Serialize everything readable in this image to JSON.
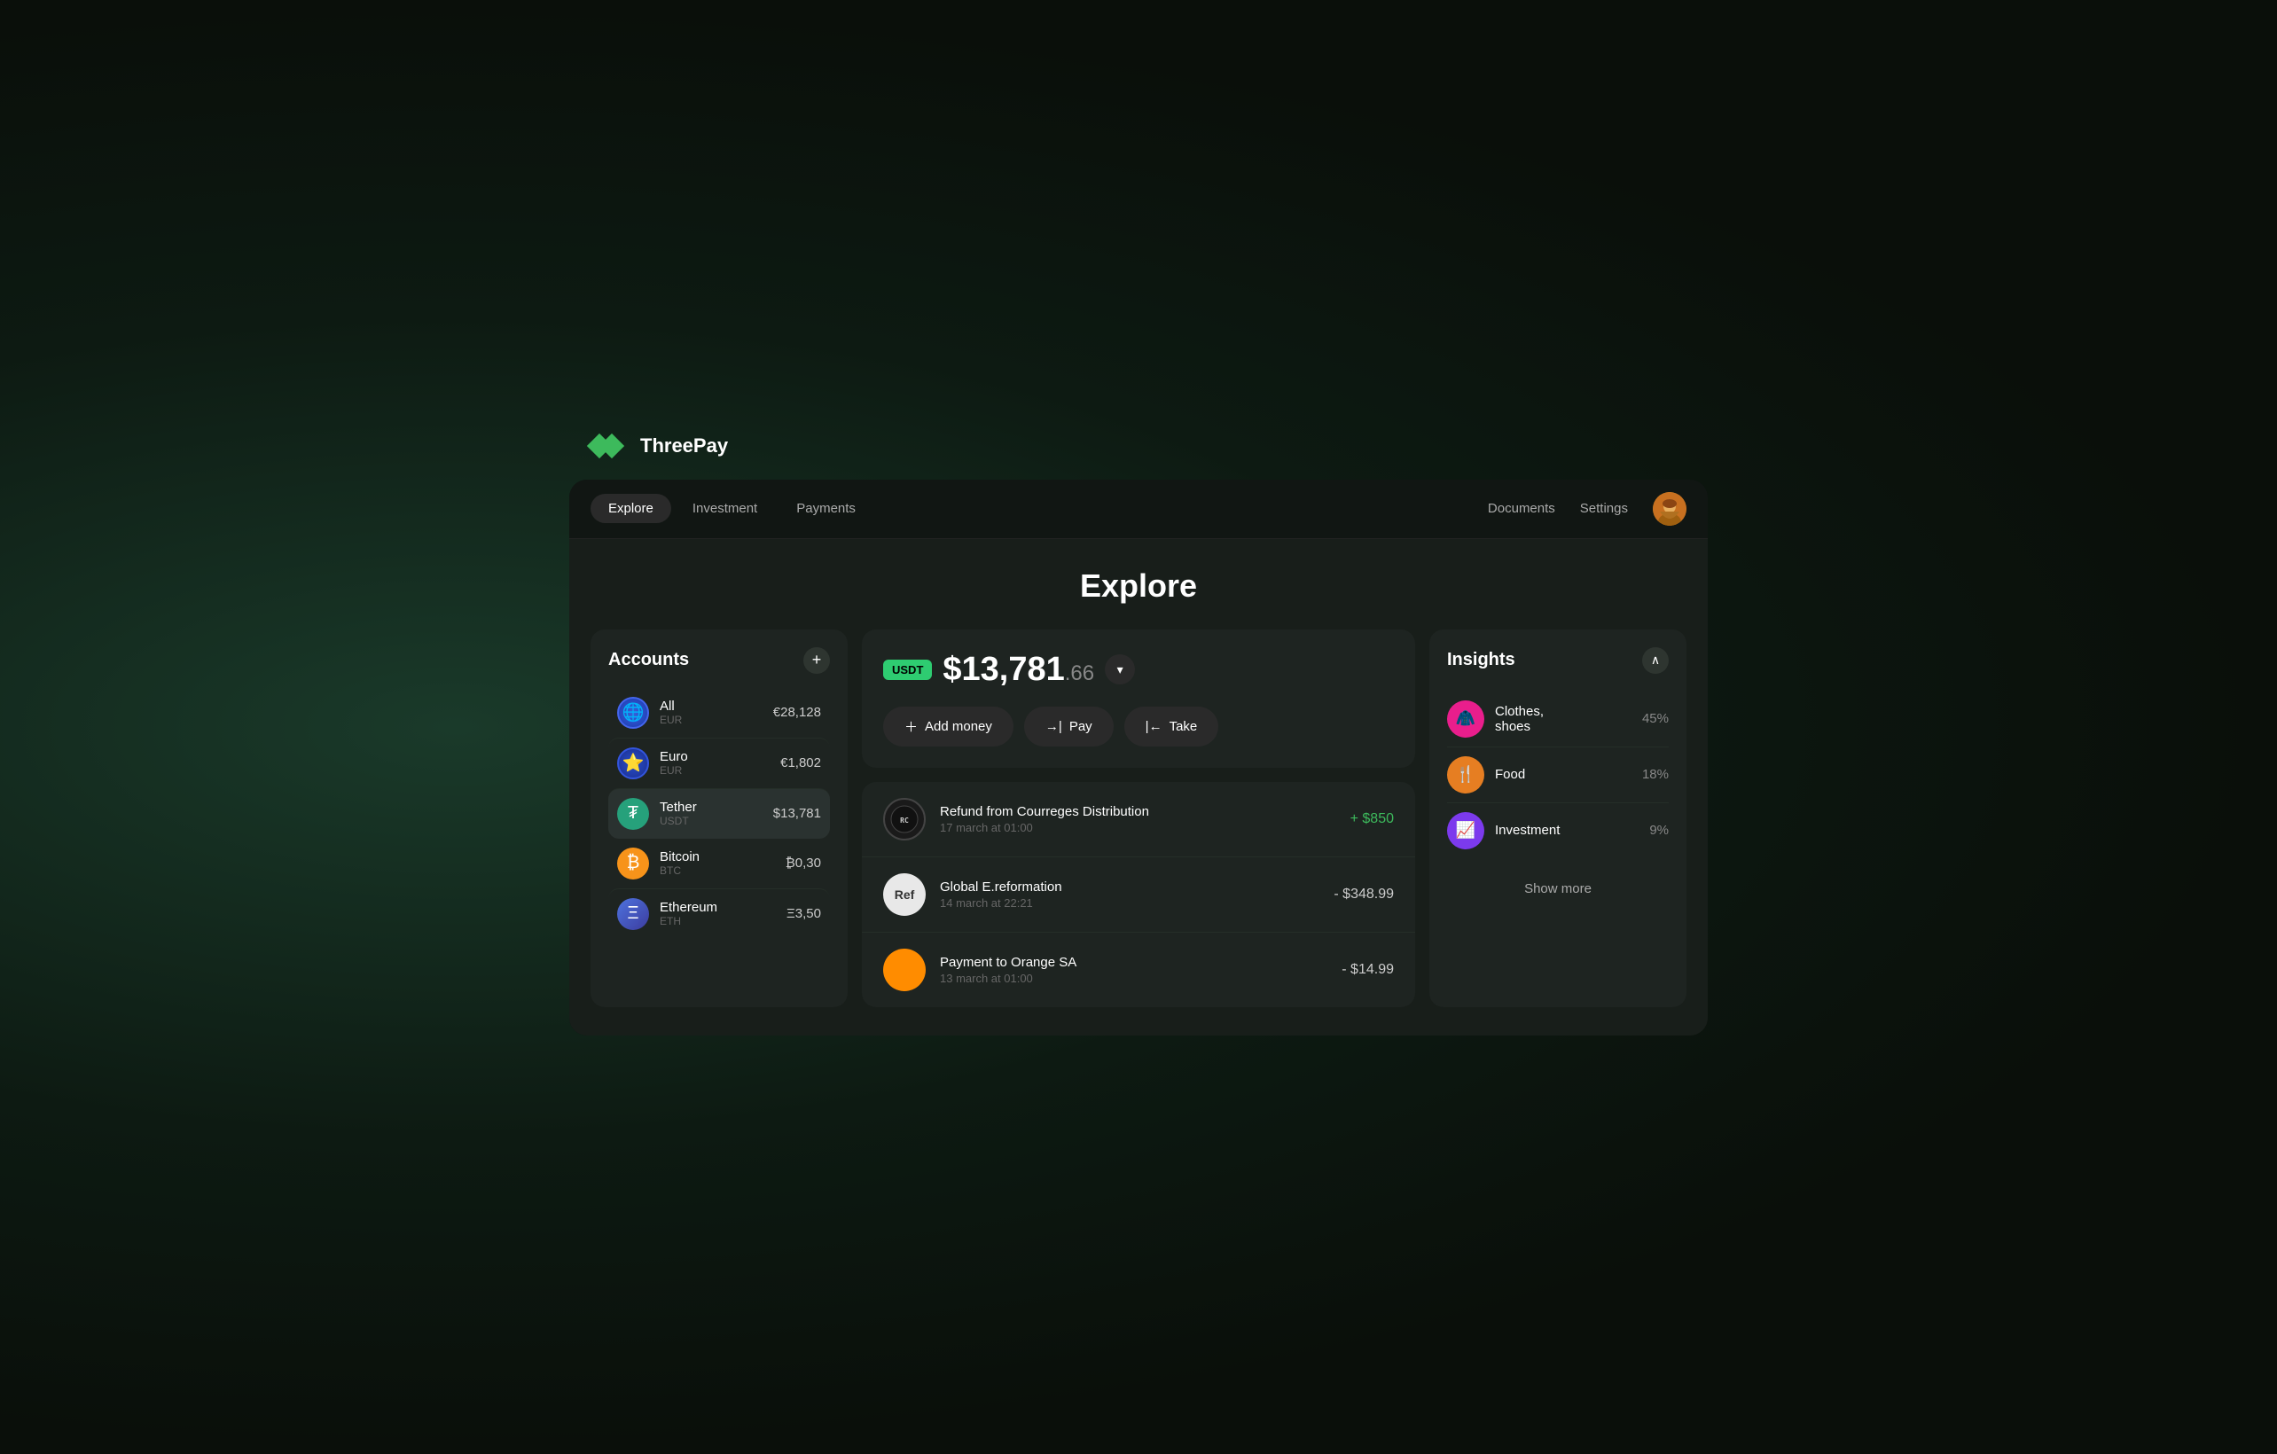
{
  "app": {
    "name": "ThreePay"
  },
  "nav": {
    "tabs": [
      {
        "id": "explore",
        "label": "Explore",
        "active": true
      },
      {
        "id": "investment",
        "label": "Investment",
        "active": false
      },
      {
        "id": "payments",
        "label": "Payments",
        "active": false
      }
    ],
    "links": [
      {
        "id": "documents",
        "label": "Documents"
      },
      {
        "id": "settings",
        "label": "Settings"
      }
    ]
  },
  "page": {
    "title": "Explore"
  },
  "accounts": {
    "title": "Accounts",
    "add_label": "+",
    "items": [
      {
        "id": "all",
        "name": "All",
        "sub": "EUR",
        "balance": "€28,128",
        "icon": "🌐",
        "icon_bg": "#2655d8",
        "active": false
      },
      {
        "id": "euro",
        "name": "Euro",
        "sub": "EUR",
        "balance": "€1,802",
        "icon": "🇪🇺",
        "icon_bg": "#1a3a9e",
        "active": false
      },
      {
        "id": "tether",
        "name": "Tether",
        "sub": "USDT",
        "balance": "$13,781",
        "icon": "₮",
        "icon_bg": "#26a17b",
        "active": true
      },
      {
        "id": "bitcoin",
        "name": "Bitcoin",
        "sub": "BTC",
        "balance": "₿0,30",
        "icon": "₿",
        "icon_bg": "#f7931a",
        "active": false
      },
      {
        "id": "ethereum",
        "name": "Ethereum",
        "sub": "ETH",
        "balance": "Ξ3,50",
        "icon": "Ξ",
        "icon_bg": "#3c3c8e",
        "active": false
      }
    ]
  },
  "balance": {
    "currency_badge": "USDT",
    "amount_main": "$13,781",
    "amount_cents": ".66"
  },
  "actions": [
    {
      "id": "add-money",
      "label": "Add money",
      "icon": "+"
    },
    {
      "id": "pay",
      "label": "Pay",
      "icon": "→|"
    },
    {
      "id": "take",
      "label": "Take",
      "icon": "|←"
    }
  ],
  "transactions": [
    {
      "id": "tx1",
      "name": "Refund from Courreges Distribution",
      "date": "17 march at 01:00",
      "amount": "+ $850",
      "positive": true,
      "icon_type": "courreges",
      "icon_text": "RC"
    },
    {
      "id": "tx2",
      "name": "Global E.reformation",
      "date": "14 march at 22:21",
      "amount": "- $348.99",
      "positive": false,
      "icon_type": "ref",
      "icon_text": "Ref"
    },
    {
      "id": "tx3",
      "name": "Payment to Orange SA",
      "date": "13 march at 01:00",
      "amount": "- $14.99",
      "positive": false,
      "icon_type": "orange",
      "icon_text": "🍊"
    }
  ],
  "insights": {
    "title": "Insights",
    "items": [
      {
        "id": "clothes",
        "label": "Clothes,\nshoes",
        "label_line1": "Clothes,",
        "label_line2": "shoes",
        "pct": "45%",
        "icon": "🧥",
        "icon_bg": "#e91e8c"
      },
      {
        "id": "food",
        "label": "Food",
        "pct": "18%",
        "icon": "🍴",
        "icon_bg": "#e67e22"
      },
      {
        "id": "investment",
        "label": "Investment",
        "pct": "9%",
        "icon": "📈",
        "icon_bg": "#7c3aed"
      }
    ],
    "show_more_label": "Show more"
  }
}
